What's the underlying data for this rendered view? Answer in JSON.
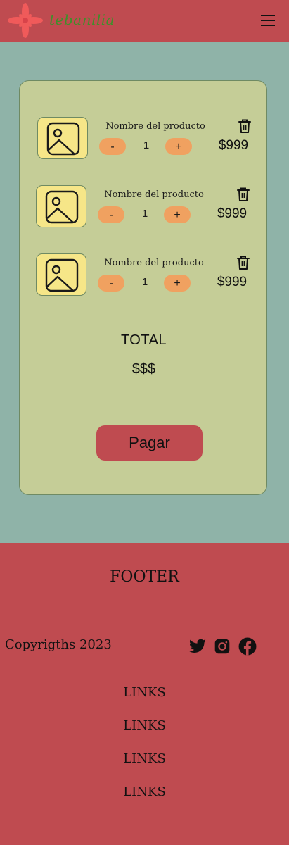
{
  "header": {
    "brand": "tebanilia",
    "menu_icon": "hamburger-menu-icon",
    "logo_icon": "flower-logo-icon"
  },
  "cart": {
    "items": [
      {
        "name": "Nombre del producto",
        "quantity": "1",
        "minus_label": "-",
        "plus_label": "+",
        "price": "$999",
        "image_icon": "image-placeholder-icon",
        "delete_icon": "trash-icon"
      },
      {
        "name": "Nombre del producto",
        "quantity": "1",
        "minus_label": "-",
        "plus_label": "+",
        "price": "$999",
        "image_icon": "image-placeholder-icon",
        "delete_icon": "trash-icon"
      },
      {
        "name": "Nombre del producto",
        "quantity": "1",
        "minus_label": "-",
        "plus_label": "+",
        "price": "$999",
        "image_icon": "image-placeholder-icon",
        "delete_icon": "trash-icon"
      }
    ],
    "total_label": "TOTAL",
    "total_value": "$$$",
    "pay_button": "Pagar"
  },
  "footer": {
    "title": "FOOTER",
    "copyright": "Copyrigths 2023",
    "social_icons": [
      "twitter-icon",
      "instagram-icon",
      "facebook-icon"
    ],
    "links": [
      "LINKS",
      "LINKS",
      "LINKS",
      "LINKS"
    ]
  },
  "colors": {
    "background": "#8fb3a8",
    "header_footer": "#bf4b50",
    "card": "#c5cd97",
    "thumbnail": "#f6e688",
    "quantity_button": "#f0a160",
    "logo_flower": "#f05a5a",
    "brand_text": "#3f8f2a"
  }
}
